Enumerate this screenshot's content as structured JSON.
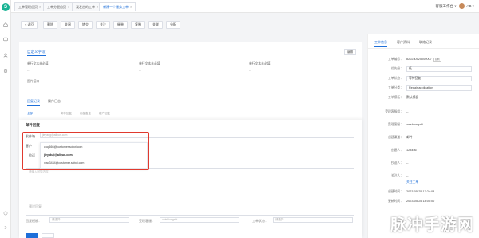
{
  "app": {
    "logo_letter": "S"
  },
  "tabs": [
    {
      "label": "工单管理首页",
      "close": "×"
    },
    {
      "label": "工单分配首页",
      "close": "×"
    },
    {
      "label": "我发出的工单",
      "close": "×"
    },
    {
      "label": "新建一个服务工单",
      "close": "×"
    }
  ],
  "topright": {
    "workspace": "客服工作台 ▾",
    "user": "AB ▾"
  },
  "toolbar": [
    "< 返回",
    "删除",
    "关闭",
    "转交",
    "关注",
    "催单",
    "复制",
    "关联",
    "分配"
  ],
  "custom_section": {
    "title": "自定义字段",
    "edit": "编辑",
    "fields": [
      {
        "label": "单行文本未必填",
        "value": "--"
      },
      {
        "label": "单行文本未必填",
        "value": "--"
      },
      {
        "label": "单行文本未必填",
        "value": "--"
      }
    ],
    "image_label": "图片接口"
  },
  "record_tabs": [
    "回复记录",
    "操作日志"
  ],
  "modal": {
    "title": "邮件回复",
    "reply_types": [
      "全部",
      "邮件回复",
      "内部备注",
      "客户回复"
    ],
    "to_label": "发件箱",
    "to_value": "jieyang@aliyun.com",
    "customer_label": "客户",
    "cc_label": "抄送",
    "body_placeholder": "请输入回复内容",
    "preset_label": "预设回复",
    "bottom": [
      {
        "label": "回复模板：",
        "value": "请选择"
      },
      {
        "label": "受理客服：",
        "value": "zaishiongzhi"
      },
      {
        "label": "工单状态：",
        "value": "请选择"
      }
    ]
  },
  "dropdown": {
    "options": [
      "cuqi666@customer.sobot.com",
      "jieyiduji@aliyun.com",
      "xiao3434@customer.sobot.com"
    ],
    "selected_index": 1
  },
  "right_panel": {
    "tabs": [
      "工单信息",
      "客户资料",
      "联络记录"
    ],
    "rows": [
      {
        "label": "工单编号：",
        "value": "#20230525000007",
        "badge": "复制"
      },
      {
        "label": "优先级：",
        "value": "低",
        "select": true
      },
      {
        "label": "工单状态：",
        "value": "等待回复",
        "select": true
      },
      {
        "label": "工单分类：",
        "value": "Repair application",
        "select": true
      },
      {
        "label": "工单模板：",
        "value": "默认模板"
      },
      {
        "label": "受理客服组：",
        "value": "--"
      },
      {
        "label": "受理客服：",
        "value": "zaishiongzhi"
      },
      {
        "label": "创建渠道：",
        "value": "邮件"
      },
      {
        "label": "创建人：",
        "value": "123456"
      },
      {
        "label": "抄送人：",
        "value": "--"
      },
      {
        "label": "关注人：",
        "value": "--"
      },
      {
        "label": "",
        "value": "关注工单"
      },
      {
        "label": "创建时间：",
        "value": "2023-05-25 17:24:08"
      },
      {
        "label": "更新时间：",
        "value": "2023-05-25 18:00:00"
      }
    ]
  },
  "watermark": "脉冲手游网",
  "colors": {
    "accent": "#1e6fd9",
    "highlight": "#e03a2f",
    "brand": "#19b394"
  }
}
